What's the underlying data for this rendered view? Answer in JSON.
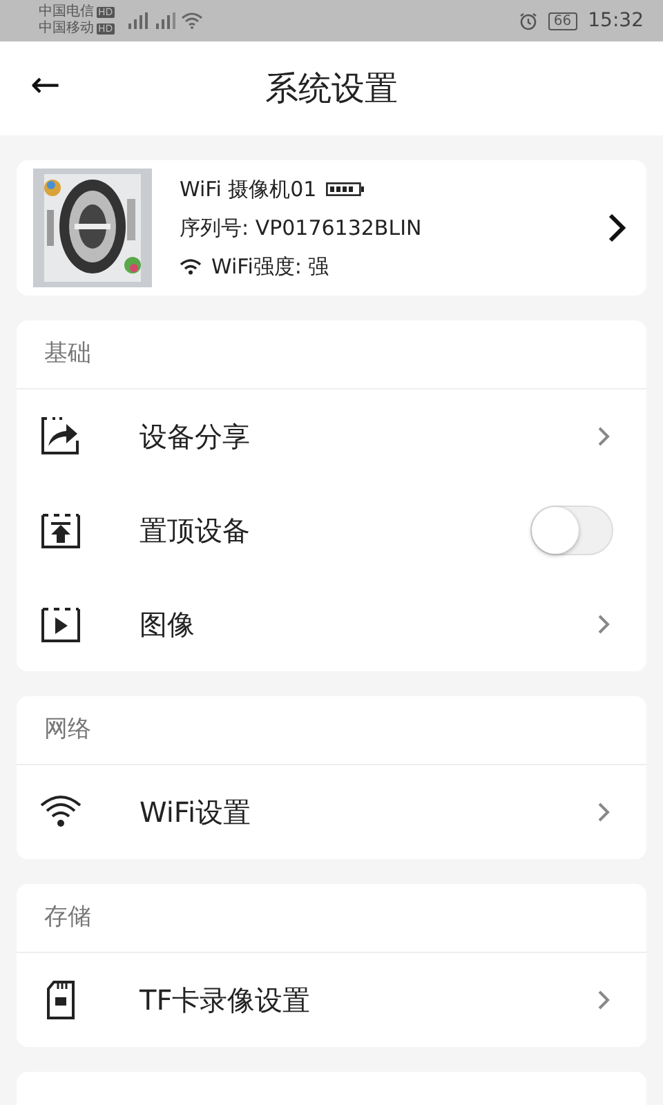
{
  "status_bar": {
    "carriers": [
      {
        "name": "中国电信",
        "badge": "HD"
      },
      {
        "name": "中国移动",
        "badge": "HD"
      }
    ],
    "battery": "66",
    "time": "15:32"
  },
  "header": {
    "back": "←",
    "title": "系统设置"
  },
  "device": {
    "name": "WiFi 摄像机01",
    "serial": "序列号: VP0176132BLIN",
    "wifi": "WiFi强度: 强"
  },
  "sections": [
    {
      "title": "基础",
      "rows": [
        {
          "kind": "link",
          "label": "设备分享"
        },
        {
          "kind": "toggle",
          "label": "置顶设备",
          "on": false
        },
        {
          "kind": "link",
          "label": "图像"
        }
      ]
    },
    {
      "title": "网络",
      "rows": [
        {
          "kind": "link",
          "label": "WiFi设置"
        }
      ]
    },
    {
      "title": "存储",
      "rows": [
        {
          "kind": "link",
          "label": "TF卡录像设置"
        }
      ]
    }
  ]
}
